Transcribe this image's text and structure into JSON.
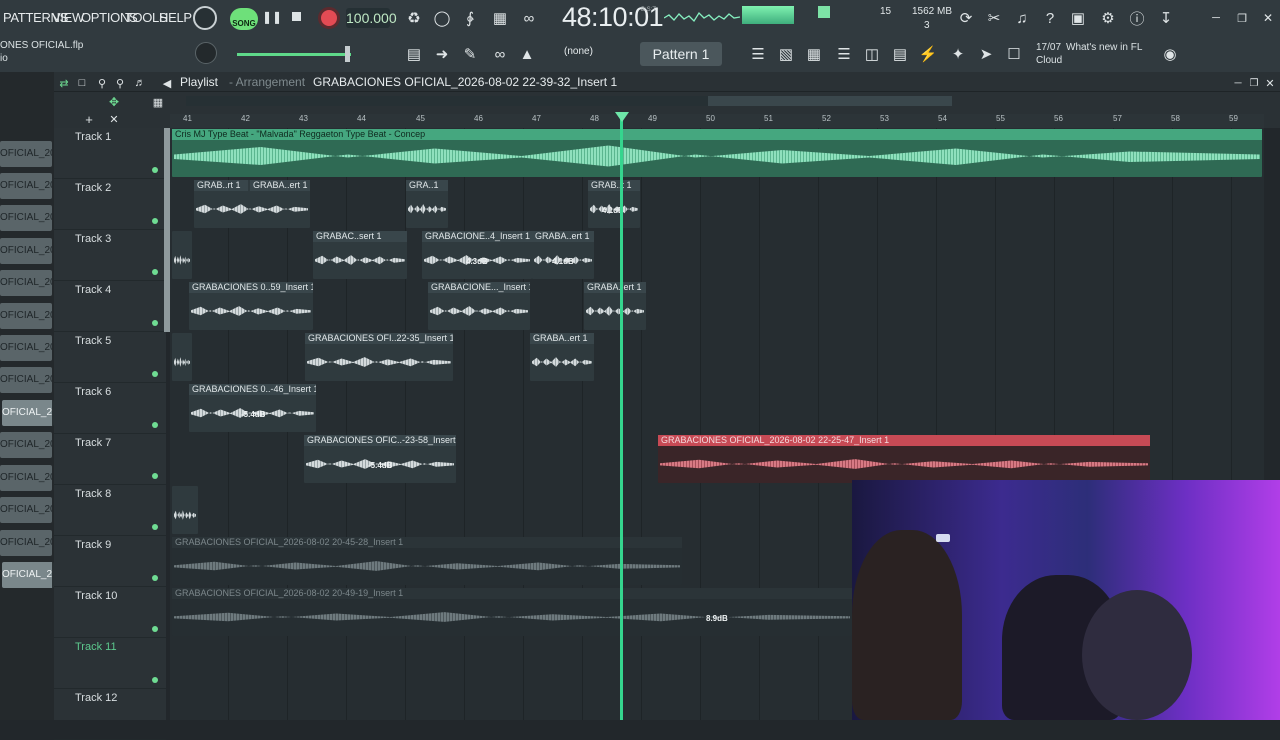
{
  "menu": {
    "patterns": "PATTERNS",
    "view": "VIEW",
    "options": "OPTIONS",
    "tools": "TOOLS",
    "help": "HELP"
  },
  "transport": {
    "song_label": "SONG",
    "tempo": "100.000",
    "time": "48:10:01",
    "time_unit": "B:S:T",
    "poly": "15",
    "memory": "1562 MB",
    "voices": "3"
  },
  "file": {
    "name": "ONES OFICIAL.flp",
    "sub": "io"
  },
  "pattern": {
    "none_label": "(none)",
    "name": "Pattern 1"
  },
  "news": {
    "date": "17/07",
    "text": "What's new in FL",
    "sub": "Cloud"
  },
  "browser_items": [
    "OFICIAL_20...",
    "OFICIAL_20...",
    "OFICIAL_20...",
    "OFICIAL_20...",
    "OFICIAL_20...",
    "OFICIAL_20...",
    "OFICIAL_20...",
    "OFICIAL_20...",
    "OFICIAL_20...",
    "OFICIAL_20...",
    "OFICIAL_20...",
    "OFICIAL_20...",
    "OFICIAL_20...",
    "OFICIAL_20...",
    "OFICIAL_20..."
  ],
  "playlist": {
    "title": "Playlist",
    "title_sub": "- Arrangement",
    "file": "GRABACIONES OFICIAL_2026-08-02 22-39-32_Insert 1"
  },
  "ruler": [
    "41",
    "42",
    "43",
    "44",
    "45",
    "46",
    "47",
    "48",
    "49",
    "50",
    "51",
    "52",
    "53",
    "54",
    "55",
    "56",
    "57",
    "58",
    "59"
  ],
  "tracks": [
    "Track 1",
    "Track 2",
    "Track 3",
    "Track 4",
    "Track 5",
    "Track 6",
    "Track 7",
    "Track 8",
    "Track 9",
    "Track 10",
    "Track 11",
    "Track 12"
  ],
  "clips": {
    "c1": "Cris MJ Type Beat - \"Malvada\" Reggaeton Type Beat - Concep",
    "c2a": "GRAB..rt 1",
    "c2b": "GRABA..ert 1",
    "c2c": "GRA..1",
    "c2d": "GRAB..t 1",
    "g2d": "4.1dB",
    "c3b": "GRABAC..sert 1",
    "c3c": "GRABACIONE..4_Insert 1",
    "c3d": "GRABA..ert 1",
    "g3c": "4.3dB",
    "g3d": "4.1dB",
    "c4a": "GRABACIONES 0..59_Insert 1",
    "c4b": "GRABACIONE..._Insert 1",
    "c4c": "GRABA..ert 1",
    "c5b": "GRABACIONES OFI..22-35_Insert 1",
    "c5c": "GRABA..ert 1",
    "c6a": "GRABACIONES 0..-46_Insert 1",
    "g6a": "-5.4dB",
    "c7a": "GRABACIONES OFIC..-23-58_Insert 1",
    "g7a": "-5.4dB",
    "c7b": "GRABACIONES OFICIAL_2026-08-02 22-25-47_Insert 1",
    "c9": "GRABACIONES OFICIAL_2026-08-02 20-45-28_Insert 1",
    "c10": "GRABACIONES OFICIAL_2026-08-02 20-49-19_Insert 1",
    "g10": "8.9dB"
  }
}
